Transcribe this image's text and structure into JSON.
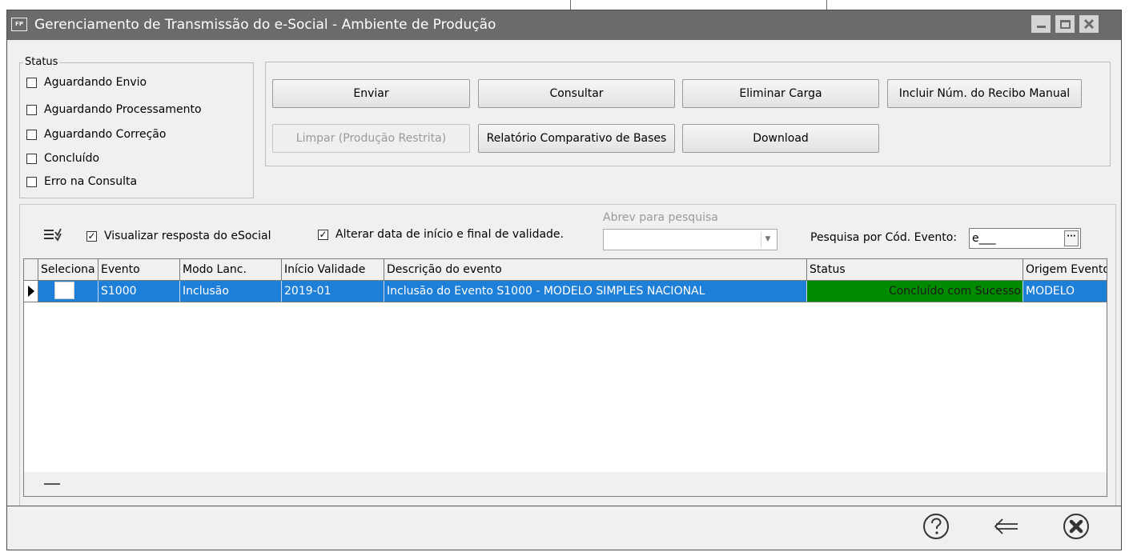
{
  "window": {
    "icon_text": "FP",
    "title": "Gerenciamento de Transmissão do e-Social - Ambiente de Produção"
  },
  "status_group": {
    "legend": "Status",
    "options": [
      {
        "label": "Aguardando Envio",
        "checked": false
      },
      {
        "label": "Aguardando Processamento",
        "checked": false
      },
      {
        "label": "Aguardando Correção",
        "checked": false
      },
      {
        "label": "Concluído",
        "checked": false
      },
      {
        "label": "Erro na Consulta",
        "checked": false
      }
    ]
  },
  "actions": {
    "enviar": "Enviar",
    "consultar": "Consultar",
    "eliminar_carga": "Eliminar Carga",
    "incluir_recibo": "Incluir Núm. do Recibo Manual",
    "limpar": "Limpar (Produção Restrita)",
    "relatorio": "Relatório Comparativo de Bases",
    "download": "Download"
  },
  "filters": {
    "visualizar_resposta": {
      "label": "Visualizar resposta do eSocial",
      "checked": true
    },
    "alterar_data": {
      "label": "Alterar data de início e final de validade.",
      "checked": true
    },
    "abrev_label": "Abrev para pesquisa",
    "abrev_value": "",
    "pesquisa_label": "Pesquisa por Cód. Evento:",
    "pesquisa_value": "e___",
    "checkmark": "✓"
  },
  "grid": {
    "columns": [
      "Seleciona",
      "Evento",
      "Modo Lanc.",
      "Início Validade",
      "Descrição do evento",
      "Status",
      "Origem Evento"
    ],
    "rows": [
      {
        "selected": false,
        "evento": "S1000",
        "modo": "Inclusão",
        "inicio": "2019-01",
        "descricao": "Inclusão do Evento S1000 - MODELO SIMPLES NACIONAL",
        "status": "Concluído com Sucesso",
        "origem": "MODELO"
      }
    ]
  },
  "colors": {
    "titlebar": "#6b6b6b",
    "row_selected": "#1e7fd8",
    "status_success": "#008a00"
  },
  "icons": [
    "app-icon",
    "minimize-icon",
    "maximize-icon",
    "close-icon",
    "filter-list-icon",
    "dropdown-arrow-icon",
    "ellipsis-icon",
    "row-pointer-icon",
    "help-icon",
    "back-arrow-icon",
    "close-circle-icon"
  ]
}
